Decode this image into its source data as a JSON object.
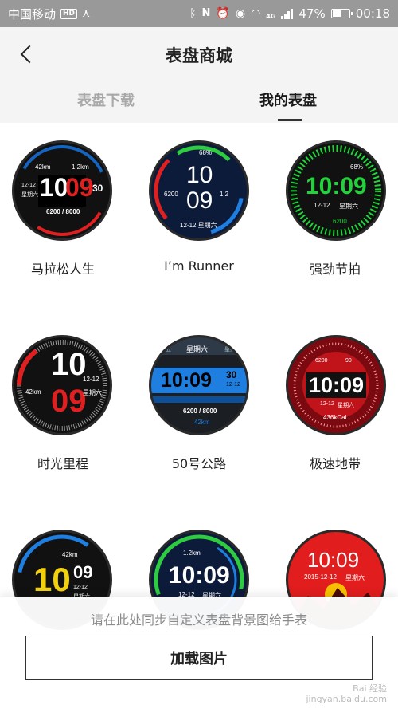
{
  "status_bar": {
    "carrier": "中国移动",
    "hd": "HD",
    "battery_pct": "47%",
    "battery_level": 0.47,
    "time": "00:18",
    "net": "4G"
  },
  "header": {
    "title": "表盘商城",
    "tabs": [
      {
        "label": "表盘下载",
        "active": false
      },
      {
        "label": "我的表盘",
        "active": true
      }
    ]
  },
  "faces": [
    {
      "name": "马拉松人生",
      "accent": "#e02020",
      "date": "12-12",
      "weekday": "星期六",
      "hour": "10",
      "minute": "09",
      "sec": "30",
      "dist": "42km",
      "dist2": "1.2km",
      "steps": "6200 / 8000"
    },
    {
      "name": "I’m Runner",
      "accent": "#2ecc40",
      "battery": "68%",
      "hour": "10",
      "minute": "09",
      "steps": "6200",
      "dist": "1.2",
      "date": "12-12 星期六"
    },
    {
      "name": "强劲节拍",
      "accent": "#22d23a",
      "battery": "68%",
      "hour": "10:09",
      "date": "12-12",
      "weekday": "星期六",
      "steps": "6200"
    },
    {
      "name": "时光里程",
      "accent": "#e02020",
      "hour": "10",
      "minute": "09",
      "dist": "42km",
      "date": "12-12",
      "weekday": "星期六"
    },
    {
      "name": "50号公路",
      "accent": "#1e7fe0",
      "weekday_top": "星期六",
      "hour": "10:09",
      "sec": "30",
      "date": "12-12",
      "steps": "6200 / 8000",
      "dist": "42km",
      "left_tag": "星期五",
      "right_tag": "星期日"
    },
    {
      "name": "极速地带",
      "accent": "#c0141a",
      "hour": "10:09",
      "date": "12-12",
      "weekday": "星期六",
      "kcal": "436kCal",
      "steps": "6200",
      "bpm": "90"
    },
    {
      "name": "",
      "accent": "#f2d10c",
      "hour": "10",
      "minute": "09",
      "dist": "42km",
      "date": "12-12",
      "weekday": "星期六"
    },
    {
      "name": "",
      "accent": "#2ecc40",
      "dist": "1.2km",
      "hour": "10:09",
      "date": "12-12",
      "weekday": "星期六"
    },
    {
      "name": "",
      "accent": "#e21d1d",
      "hour": "10:09",
      "date": "2015-12-12",
      "weekday": "星期六"
    }
  ],
  "bottom": {
    "hint": "请在此处同步自定义表盘背景图给手表",
    "button": "加载图片"
  },
  "watermark": {
    "line1": "Bai 经验",
    "line2": "jingyan.baidu.com"
  }
}
